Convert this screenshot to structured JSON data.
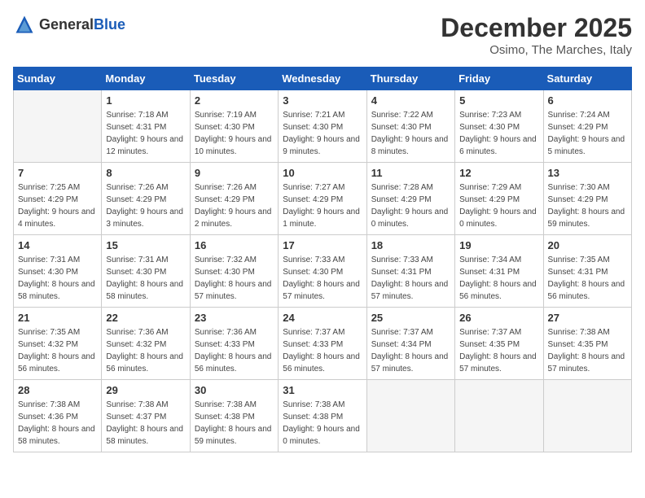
{
  "logo": {
    "general": "General",
    "blue": "Blue"
  },
  "header": {
    "month": "December 2025",
    "location": "Osimo, The Marches, Italy"
  },
  "weekdays": [
    "Sunday",
    "Monday",
    "Tuesday",
    "Wednesday",
    "Thursday",
    "Friday",
    "Saturday"
  ],
  "weeks": [
    [
      {
        "day": "",
        "sunrise": "",
        "sunset": "",
        "daylight": ""
      },
      {
        "day": "1",
        "sunrise": "Sunrise: 7:18 AM",
        "sunset": "Sunset: 4:31 PM",
        "daylight": "Daylight: 9 hours and 12 minutes."
      },
      {
        "day": "2",
        "sunrise": "Sunrise: 7:19 AM",
        "sunset": "Sunset: 4:30 PM",
        "daylight": "Daylight: 9 hours and 10 minutes."
      },
      {
        "day": "3",
        "sunrise": "Sunrise: 7:21 AM",
        "sunset": "Sunset: 4:30 PM",
        "daylight": "Daylight: 9 hours and 9 minutes."
      },
      {
        "day": "4",
        "sunrise": "Sunrise: 7:22 AM",
        "sunset": "Sunset: 4:30 PM",
        "daylight": "Daylight: 9 hours and 8 minutes."
      },
      {
        "day": "5",
        "sunrise": "Sunrise: 7:23 AM",
        "sunset": "Sunset: 4:30 PM",
        "daylight": "Daylight: 9 hours and 6 minutes."
      },
      {
        "day": "6",
        "sunrise": "Sunrise: 7:24 AM",
        "sunset": "Sunset: 4:29 PM",
        "daylight": "Daylight: 9 hours and 5 minutes."
      }
    ],
    [
      {
        "day": "7",
        "sunrise": "Sunrise: 7:25 AM",
        "sunset": "Sunset: 4:29 PM",
        "daylight": "Daylight: 9 hours and 4 minutes."
      },
      {
        "day": "8",
        "sunrise": "Sunrise: 7:26 AM",
        "sunset": "Sunset: 4:29 PM",
        "daylight": "Daylight: 9 hours and 3 minutes."
      },
      {
        "day": "9",
        "sunrise": "Sunrise: 7:26 AM",
        "sunset": "Sunset: 4:29 PM",
        "daylight": "Daylight: 9 hours and 2 minutes."
      },
      {
        "day": "10",
        "sunrise": "Sunrise: 7:27 AM",
        "sunset": "Sunset: 4:29 PM",
        "daylight": "Daylight: 9 hours and 1 minute."
      },
      {
        "day": "11",
        "sunrise": "Sunrise: 7:28 AM",
        "sunset": "Sunset: 4:29 PM",
        "daylight": "Daylight: 9 hours and 0 minutes."
      },
      {
        "day": "12",
        "sunrise": "Sunrise: 7:29 AM",
        "sunset": "Sunset: 4:29 PM",
        "daylight": "Daylight: 9 hours and 0 minutes."
      },
      {
        "day": "13",
        "sunrise": "Sunrise: 7:30 AM",
        "sunset": "Sunset: 4:29 PM",
        "daylight": "Daylight: 8 hours and 59 minutes."
      }
    ],
    [
      {
        "day": "14",
        "sunrise": "Sunrise: 7:31 AM",
        "sunset": "Sunset: 4:30 PM",
        "daylight": "Daylight: 8 hours and 58 minutes."
      },
      {
        "day": "15",
        "sunrise": "Sunrise: 7:31 AM",
        "sunset": "Sunset: 4:30 PM",
        "daylight": "Daylight: 8 hours and 58 minutes."
      },
      {
        "day": "16",
        "sunrise": "Sunrise: 7:32 AM",
        "sunset": "Sunset: 4:30 PM",
        "daylight": "Daylight: 8 hours and 57 minutes."
      },
      {
        "day": "17",
        "sunrise": "Sunrise: 7:33 AM",
        "sunset": "Sunset: 4:30 PM",
        "daylight": "Daylight: 8 hours and 57 minutes."
      },
      {
        "day": "18",
        "sunrise": "Sunrise: 7:33 AM",
        "sunset": "Sunset: 4:31 PM",
        "daylight": "Daylight: 8 hours and 57 minutes."
      },
      {
        "day": "19",
        "sunrise": "Sunrise: 7:34 AM",
        "sunset": "Sunset: 4:31 PM",
        "daylight": "Daylight: 8 hours and 56 minutes."
      },
      {
        "day": "20",
        "sunrise": "Sunrise: 7:35 AM",
        "sunset": "Sunset: 4:31 PM",
        "daylight": "Daylight: 8 hours and 56 minutes."
      }
    ],
    [
      {
        "day": "21",
        "sunrise": "Sunrise: 7:35 AM",
        "sunset": "Sunset: 4:32 PM",
        "daylight": "Daylight: 8 hours and 56 minutes."
      },
      {
        "day": "22",
        "sunrise": "Sunrise: 7:36 AM",
        "sunset": "Sunset: 4:32 PM",
        "daylight": "Daylight: 8 hours and 56 minutes."
      },
      {
        "day": "23",
        "sunrise": "Sunrise: 7:36 AM",
        "sunset": "Sunset: 4:33 PM",
        "daylight": "Daylight: 8 hours and 56 minutes."
      },
      {
        "day": "24",
        "sunrise": "Sunrise: 7:37 AM",
        "sunset": "Sunset: 4:33 PM",
        "daylight": "Daylight: 8 hours and 56 minutes."
      },
      {
        "day": "25",
        "sunrise": "Sunrise: 7:37 AM",
        "sunset": "Sunset: 4:34 PM",
        "daylight": "Daylight: 8 hours and 57 minutes."
      },
      {
        "day": "26",
        "sunrise": "Sunrise: 7:37 AM",
        "sunset": "Sunset: 4:35 PM",
        "daylight": "Daylight: 8 hours and 57 minutes."
      },
      {
        "day": "27",
        "sunrise": "Sunrise: 7:38 AM",
        "sunset": "Sunset: 4:35 PM",
        "daylight": "Daylight: 8 hours and 57 minutes."
      }
    ],
    [
      {
        "day": "28",
        "sunrise": "Sunrise: 7:38 AM",
        "sunset": "Sunset: 4:36 PM",
        "daylight": "Daylight: 8 hours and 58 minutes."
      },
      {
        "day": "29",
        "sunrise": "Sunrise: 7:38 AM",
        "sunset": "Sunset: 4:37 PM",
        "daylight": "Daylight: 8 hours and 58 minutes."
      },
      {
        "day": "30",
        "sunrise": "Sunrise: 7:38 AM",
        "sunset": "Sunset: 4:38 PM",
        "daylight": "Daylight: 8 hours and 59 minutes."
      },
      {
        "day": "31",
        "sunrise": "Sunrise: 7:38 AM",
        "sunset": "Sunset: 4:38 PM",
        "daylight": "Daylight: 9 hours and 0 minutes."
      },
      {
        "day": "",
        "sunrise": "",
        "sunset": "",
        "daylight": ""
      },
      {
        "day": "",
        "sunrise": "",
        "sunset": "",
        "daylight": ""
      },
      {
        "day": "",
        "sunrise": "",
        "sunset": "",
        "daylight": ""
      }
    ]
  ]
}
